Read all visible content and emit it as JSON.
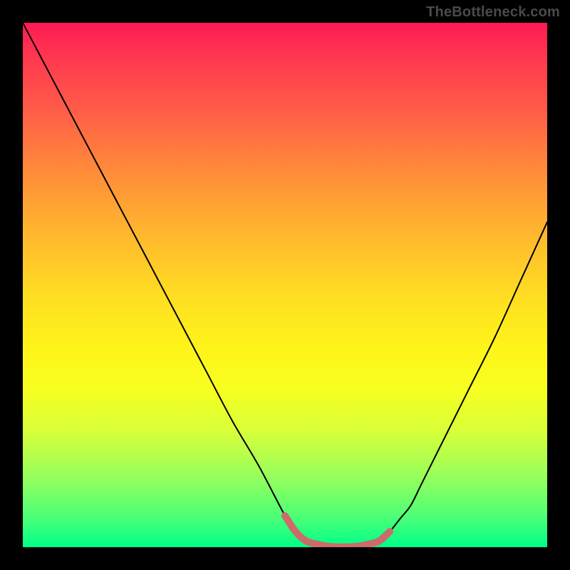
{
  "watermark": "TheBottleneck.com",
  "chart_data": {
    "type": "line",
    "title": "",
    "xlabel": "",
    "ylabel": "",
    "xlim": [
      0,
      100
    ],
    "ylim": [
      0,
      100
    ],
    "x": [
      0,
      5,
      10,
      15,
      20,
      25,
      30,
      35,
      40,
      45,
      50,
      52,
      54,
      56,
      58,
      60,
      62,
      64,
      66,
      68,
      70,
      72,
      74,
      76,
      80,
      85,
      90,
      95,
      100
    ],
    "values": [
      100,
      90.5,
      81,
      71.5,
      62,
      52.5,
      43,
      33.5,
      24,
      15.5,
      6,
      3,
      1.2,
      0.6,
      0.2,
      0.05,
      0.05,
      0.2,
      0.6,
      1.2,
      3,
      5.5,
      8,
      12,
      20,
      30,
      40,
      51,
      62
    ],
    "marker_x_range": [
      50,
      70
    ],
    "marker_color": "#cc6b6b",
    "curve_color": "#000000",
    "background_gradient": [
      "#ff1a54",
      "#ffdd22",
      "#00ff88"
    ]
  }
}
